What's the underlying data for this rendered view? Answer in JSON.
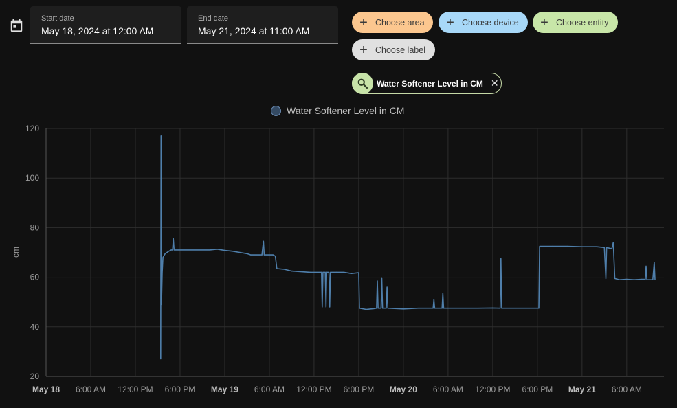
{
  "date_picker": {
    "start_label": "Start date",
    "start_value": "May 18, 2024 at 12:00 AM",
    "end_label": "End date",
    "end_value": "May 21, 2024 at 11:00 AM"
  },
  "target_picker": {
    "area": {
      "label": "Choose area",
      "color": "#fcc78f"
    },
    "device": {
      "label": "Choose device",
      "color": "#a8d8f8"
    },
    "entity": {
      "label": "Choose entity",
      "color": "#c8e6a8"
    },
    "label": {
      "label": "Choose label",
      "color": "#e0e0e0"
    }
  },
  "selected_entity": {
    "name": "Water Softener Level in CM",
    "icon": "magnify-icon",
    "remove_icon": "close-icon"
  },
  "chart_data": {
    "type": "line",
    "legend": "top-center",
    "ylabel": "cm",
    "ylim": [
      20,
      120
    ],
    "yticks": [
      20,
      40,
      60,
      80,
      100,
      120
    ],
    "x_range_hours": [
      0,
      83
    ],
    "xticks": [
      {
        "label": "May 18",
        "hour": 0,
        "bold": true
      },
      {
        "label": "6:00 AM",
        "hour": 6
      },
      {
        "label": "12:00 PM",
        "hour": 12
      },
      {
        "label": "6:00 PM",
        "hour": 18
      },
      {
        "label": "May 19",
        "hour": 24,
        "bold": true
      },
      {
        "label": "6:00 AM",
        "hour": 30
      },
      {
        "label": "12:00 PM",
        "hour": 36
      },
      {
        "label": "6:00 PM",
        "hour": 42
      },
      {
        "label": "May 20",
        "hour": 48,
        "bold": true
      },
      {
        "label": "6:00 AM",
        "hour": 54
      },
      {
        "label": "12:00 PM",
        "hour": 60
      },
      {
        "label": "6:00 PM",
        "hour": 66
      },
      {
        "label": "May 21",
        "hour": 72,
        "bold": true
      },
      {
        "label": "6:00 AM",
        "hour": 78
      }
    ],
    "grid": true,
    "series": [
      {
        "name": "Water Softener Level in CM",
        "color": "#4f7fab",
        "points": [
          [
            15.4,
            27
          ],
          [
            15.45,
            117
          ],
          [
            15.5,
            49
          ],
          [
            15.6,
            62
          ],
          [
            15.7,
            68
          ],
          [
            16.0,
            69.5
          ],
          [
            16.5,
            70.5
          ],
          [
            16.8,
            71
          ],
          [
            17.0,
            71
          ],
          [
            17.1,
            75.5
          ],
          [
            17.2,
            71
          ],
          [
            20.0,
            71
          ],
          [
            22.0,
            71
          ],
          [
            23.0,
            71.3
          ],
          [
            24.0,
            70.8
          ],
          [
            25.0,
            70.5
          ],
          [
            26.0,
            70
          ],
          [
            27.0,
            69.5
          ],
          [
            27.5,
            69
          ],
          [
            28.5,
            69
          ],
          [
            29.0,
            69
          ],
          [
            29.2,
            74.5
          ],
          [
            29.3,
            69
          ],
          [
            30.5,
            69
          ],
          [
            30.8,
            68.5
          ],
          [
            31.0,
            63.5
          ],
          [
            32.0,
            63.2
          ],
          [
            33.0,
            62.5
          ],
          [
            34.0,
            62.3
          ],
          [
            35.5,
            62
          ],
          [
            37.0,
            62
          ],
          [
            37.1,
            48
          ],
          [
            37.2,
            62
          ],
          [
            37.5,
            62
          ],
          [
            37.6,
            48
          ],
          [
            37.7,
            62
          ],
          [
            38.0,
            62
          ],
          [
            38.1,
            48
          ],
          [
            38.2,
            62
          ],
          [
            39.0,
            62
          ],
          [
            40.0,
            62
          ],
          [
            41.0,
            61.5
          ],
          [
            42.0,
            61.8
          ],
          [
            42.1,
            47.5
          ],
          [
            43.0,
            47
          ],
          [
            44.0,
            47.3
          ],
          [
            44.4,
            47.5
          ],
          [
            44.5,
            58.5
          ],
          [
            44.6,
            47.5
          ],
          [
            45.0,
            47.5
          ],
          [
            45.1,
            59.5
          ],
          [
            45.2,
            47.5
          ],
          [
            45.7,
            47.5
          ],
          [
            45.8,
            56
          ],
          [
            45.9,
            47.5
          ],
          [
            48.0,
            47.2
          ],
          [
            50.0,
            47.5
          ],
          [
            52.0,
            47.5
          ],
          [
            52.1,
            51
          ],
          [
            52.2,
            47.5
          ],
          [
            53.2,
            47.5
          ],
          [
            53.3,
            53.5
          ],
          [
            53.4,
            47.5
          ],
          [
            56.0,
            47.5
          ],
          [
            58.0,
            47.5
          ],
          [
            60.0,
            47.6
          ],
          [
            61.0,
            47.5
          ],
          [
            61.1,
            67.5
          ],
          [
            61.2,
            47.5
          ],
          [
            63.0,
            47.5
          ],
          [
            64.0,
            47.5
          ],
          [
            66.0,
            47.5
          ],
          [
            66.2,
            47.5
          ],
          [
            66.3,
            72.5
          ],
          [
            68.0,
            72.5
          ],
          [
            70.0,
            72.5
          ],
          [
            72.0,
            72.3
          ],
          [
            74.0,
            72.3
          ],
          [
            75.0,
            72
          ],
          [
            75.2,
            59.5
          ],
          [
            75.3,
            72
          ],
          [
            76.0,
            71.5
          ],
          [
            76.2,
            74
          ],
          [
            76.4,
            59.5
          ],
          [
            77.0,
            59
          ],
          [
            78.0,
            59.2
          ],
          [
            79.0,
            59
          ],
          [
            80.0,
            59.2
          ],
          [
            80.5,
            59.2
          ],
          [
            80.6,
            64.5
          ],
          [
            80.7,
            59
          ],
          [
            81.5,
            59
          ],
          [
            81.7,
            66
          ],
          [
            81.8,
            59
          ]
        ]
      }
    ]
  }
}
